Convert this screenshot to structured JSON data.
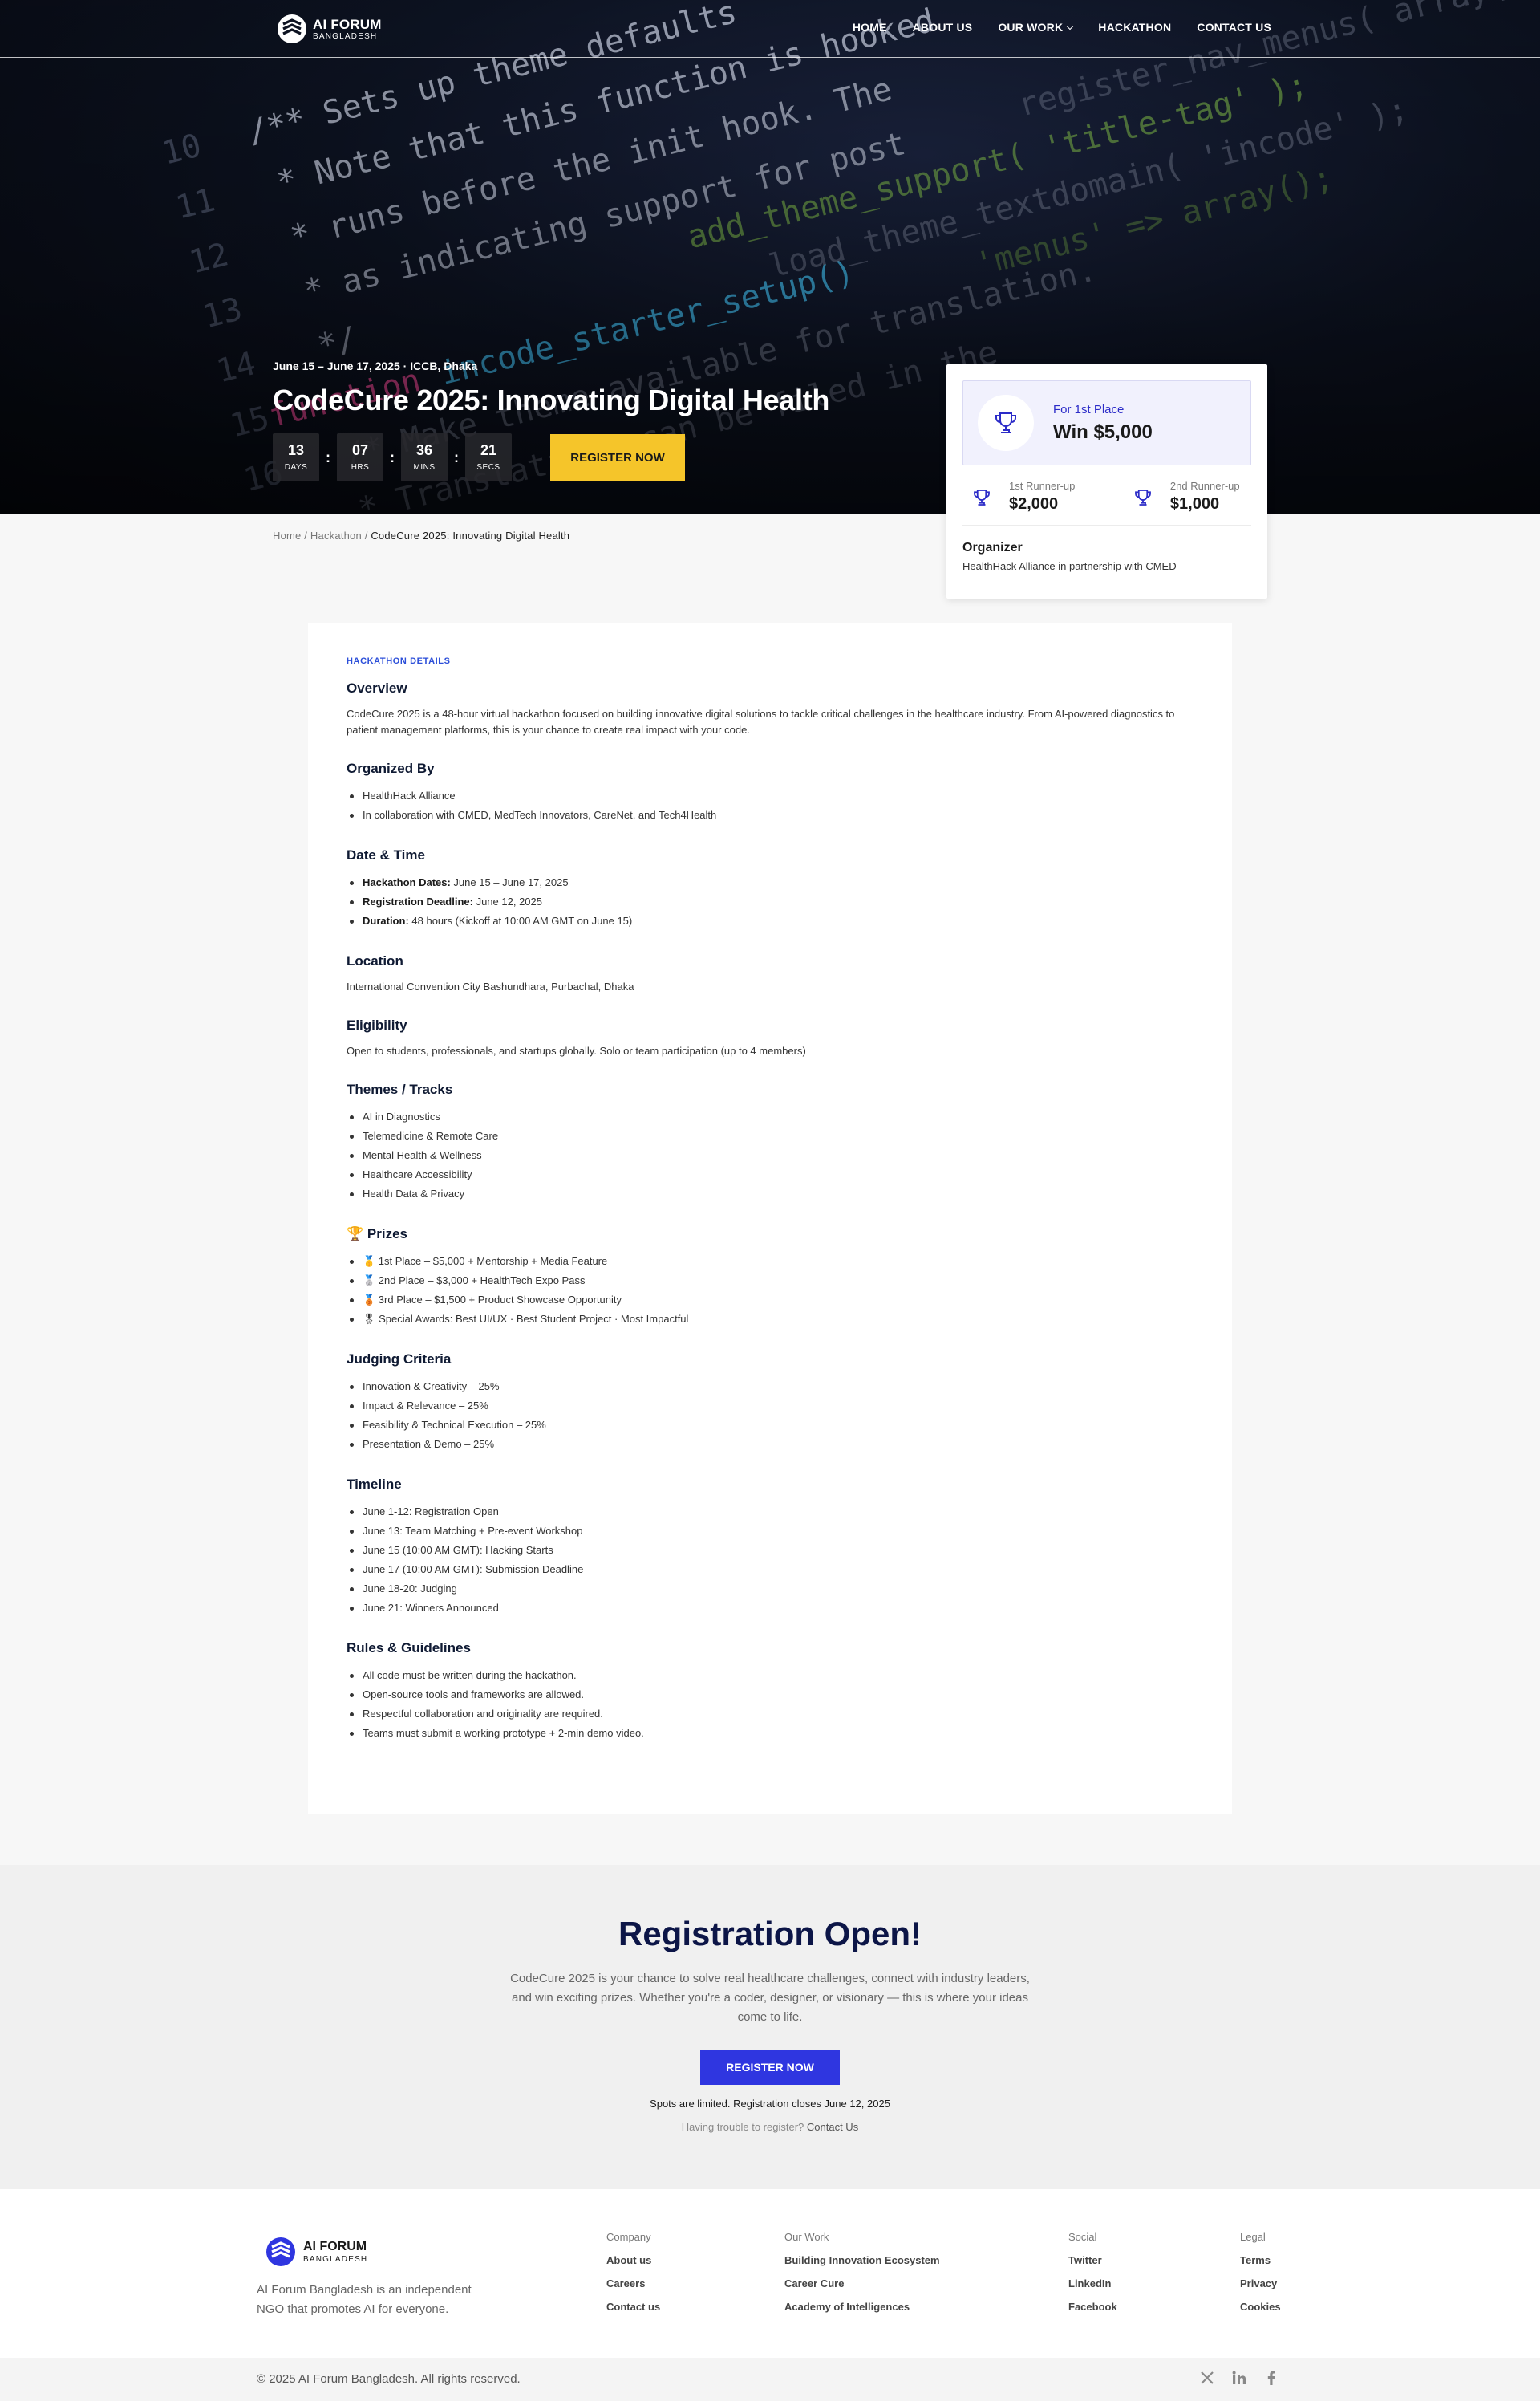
{
  "nav": {
    "logo": {
      "title": "AI FORUM",
      "subtitle": "BANGLADESH"
    },
    "links": [
      {
        "label": "HOME"
      },
      {
        "label": "ABOUT US"
      },
      {
        "label": "OUR WORK"
      },
      {
        "label": "HACKATHON"
      },
      {
        "label": "CONTACT US"
      }
    ]
  },
  "hero": {
    "meta": "June 15 – June 17, 2025 · ICCB, Dhaka",
    "title": "CodeCure 2025: Innovating Digital Health",
    "countdown": [
      {
        "value": "13",
        "label": "DAYS"
      },
      {
        "value": "07",
        "label": "HRS"
      },
      {
        "value": "36",
        "label": "MINS"
      },
      {
        "value": "21",
        "label": "SECS"
      }
    ],
    "separator": ":",
    "register_label": "REGISTER NOW",
    "accent_color": "#f5c52a"
  },
  "prize_card": {
    "first": {
      "label": "For 1st Place",
      "value": "Win $5,000"
    },
    "runners": [
      {
        "label": "1st Runner-up",
        "value": "$2,000"
      },
      {
        "label": "2nd Runner-up",
        "value": "$1,000"
      }
    ],
    "organizer_title": "Organizer",
    "organizer_text": "HealthHack Alliance in partnership with CMED",
    "icon": "trophy-icon",
    "icon_color": "#2c2cc8"
  },
  "breadcrumb": {
    "items": [
      "Home",
      "Hackathon"
    ],
    "separator": "/",
    "current": "CodeCure 2025: Innovating Digital Health"
  },
  "details": {
    "eyebrow": "HACKATHON DETAILS",
    "overview": {
      "title": "Overview",
      "text": "CodeCure 2025 is a 48-hour virtual hackathon focused on building innovative digital solutions to tackle critical challenges in the healthcare industry. From AI-powered diagnostics to patient management platforms, this is your chance to create real impact with your code."
    },
    "organized_by": {
      "title": "Organized By",
      "items": [
        "HealthHack Alliance",
        "In collaboration with CMED, MedTech Innovators, CareNet, and Tech4Health"
      ]
    },
    "date_time": {
      "title": "Date & Time",
      "items": [
        {
          "label": "Hackathon Dates:",
          "value": " June 15 – June 17, 2025"
        },
        {
          "label": "Registration Deadline:",
          "value": " June 12, 2025"
        },
        {
          "label": "Duration:",
          "value": " 48 hours (Kickoff at 10:00 AM GMT on June 15)"
        }
      ]
    },
    "location": {
      "title": "Location",
      "text": "International Convention City Bashundhara, Purbachal, Dhaka"
    },
    "eligibility": {
      "title": "Eligibility",
      "text": "Open to students, professionals, and startups globally. Solo or team participation (up to 4 members)"
    },
    "themes": {
      "title": "Themes / Tracks",
      "items": [
        "AI in Diagnostics",
        "Telemedicine & Remote Care",
        "Mental Health & Wellness",
        "Healthcare Accessibility",
        "Health Data & Privacy"
      ]
    },
    "prizes": {
      "title": "🏆 Prizes",
      "items": [
        "🥇 1st Place – $5,000 + Mentorship + Media Feature",
        "🥈 2nd Place – $3,000 + HealthTech Expo Pass",
        "🥉 3rd Place – $1,500 + Product Showcase Opportunity",
        "🎖 Special Awards: Best UI/UX · Best Student Project · Most Impactful"
      ]
    },
    "judging": {
      "title": "Judging Criteria",
      "items": [
        "Innovation & Creativity – 25%",
        "Impact & Relevance – 25%",
        "Feasibility & Technical Execution – 25%",
        "Presentation & Demo – 25%"
      ]
    },
    "timeline": {
      "title": "Timeline",
      "items": [
        "June 1-12: Registration Open",
        "June 13: Team Matching + Pre-event Workshop",
        "June 15 (10:00 AM GMT): Hacking Starts",
        "June 17 (10:00 AM GMT): Submission Deadline",
        "June 18-20: Judging",
        "June 21: Winners Announced"
      ]
    },
    "rules": {
      "title": "Rules & Guidelines",
      "items": [
        "All code must be written during the hackathon.",
        "Open-source tools and frameworks are allowed.",
        "Respectful collaboration and originality are required.",
        "Teams must submit a working prototype + 2-min demo video."
      ]
    }
  },
  "registration": {
    "title": "Registration Open!",
    "description": "CodeCure 2025 is your chance to solve real healthcare challenges, connect with industry leaders, and win exciting prizes. Whether you're a coder, designer, or visionary — this is where your ideas come to life.",
    "button": "REGISTER NOW",
    "note": "Spots are limited. Registration closes June 12, 2025",
    "help_text": "Having trouble to register?",
    "help_link": "Contact Us",
    "button_color": "#2f36e0"
  },
  "footer": {
    "logo": {
      "title": "AI FORUM",
      "subtitle": "BANGLADESH"
    },
    "description": "AI Forum Bangladesh is an independent NGO that promotes AI for everyone.",
    "columns": [
      {
        "title": "Company",
        "links": [
          "About us",
          "Careers",
          "Contact us"
        ]
      },
      {
        "title": "Our Work",
        "links": [
          "Building Innovation Ecosystem",
          "Career Cure",
          "Academy of Intelligences"
        ]
      },
      {
        "title": "Social",
        "links": [
          "Twitter",
          "LinkedIn",
          "Facebook"
        ]
      },
      {
        "title": "Legal",
        "links": [
          "Terms",
          "Privacy",
          "Cookies"
        ]
      }
    ],
    "copyright": "© 2025 AI Forum Bangladesh. All rights reserved.",
    "socials": [
      "x-icon",
      "linkedin-icon",
      "facebook-icon"
    ]
  }
}
